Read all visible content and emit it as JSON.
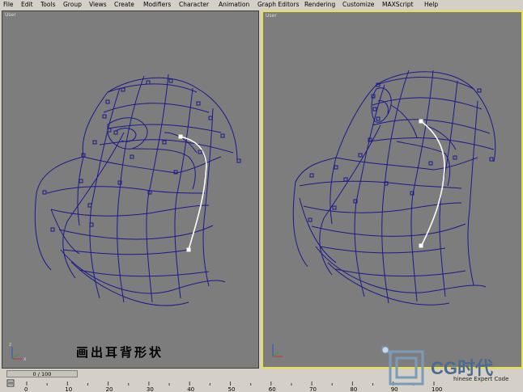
{
  "menu": [
    "File",
    "Edit",
    "Tools",
    "Group",
    "Views",
    "Create",
    "Modifiers",
    "Character",
    "Animation",
    "Graph Editors",
    "Rendering",
    "Customize",
    "MAXScript",
    "Help"
  ],
  "menu_mnemonics": [
    "F",
    "E",
    "T",
    "G",
    "V",
    "C",
    "o",
    "h",
    "A",
    "G",
    "R",
    "u",
    "M",
    "H"
  ],
  "viewports": {
    "left": {
      "label": "User"
    },
    "right": {
      "label": "User"
    }
  },
  "caption": "画出耳背形状",
  "timeline": {
    "current_frame": "0",
    "separator": "/",
    "total_frames": "100",
    "ticks": [
      "0",
      "10",
      "20",
      "30",
      "40",
      "50",
      "60",
      "70",
      "80",
      "90",
      "100"
    ]
  },
  "logo": {
    "text": "CG时代",
    "subtext": "hinese Expert Code"
  },
  "colors": {
    "ui_gray": "#d4d0c8",
    "viewport_bg": "#7d7d7d",
    "active_border": "#e8e04a",
    "spline": "#1c1a8c",
    "selected_spline": "#ffffff"
  }
}
